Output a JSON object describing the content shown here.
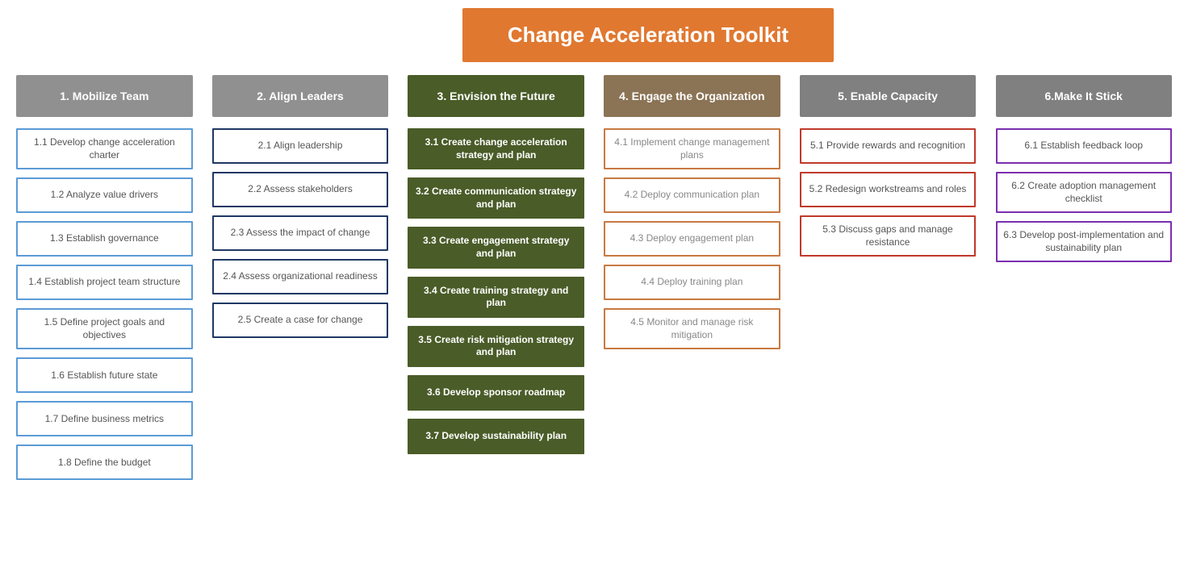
{
  "title": "Change Acceleration Toolkit",
  "cursor_visible": true,
  "columns": [
    {
      "id": "col1",
      "header": "1. Mobilize Team",
      "header_style": "gray",
      "cards": [
        {
          "label": "1.1 Develop change acceleration charter",
          "style": "border-blue"
        },
        {
          "label": "1.2 Analyze value drivers",
          "style": "border-blue"
        },
        {
          "label": "1.3 Establish governance",
          "style": "border-blue"
        },
        {
          "label": "1.4 Establish project team structure",
          "style": "border-blue"
        },
        {
          "label": "1.5 Define project goals and objectives",
          "style": "border-blue"
        },
        {
          "label": "1.6 Establish future state",
          "style": "border-blue"
        },
        {
          "label": "1.7 Define business metrics",
          "style": "border-blue"
        },
        {
          "label": "1.8 Define the budget",
          "style": "border-blue"
        }
      ]
    },
    {
      "id": "col2",
      "header": "2. Align Leaders",
      "header_style": "gray",
      "cards": [
        {
          "label": "2.1 Align leadership",
          "style": "border-dark-blue"
        },
        {
          "label": "2.2 Assess stakeholders",
          "style": "border-dark-blue"
        },
        {
          "label": "2.3 Assess the impact of change",
          "style": "border-dark-blue"
        },
        {
          "label": "2.4 Assess organizational readiness",
          "style": "border-dark-blue"
        },
        {
          "label": "2.5 Create a case for change",
          "style": "border-dark-blue"
        }
      ]
    },
    {
      "id": "col3",
      "header": "3. Envision the Future",
      "header_style": "dark-green",
      "cards": [
        {
          "label": "3.1 Create change acceleration strategy and plan",
          "style": "border-green-fill"
        },
        {
          "label": "3.2 Create communication strategy and plan",
          "style": "border-green-fill"
        },
        {
          "label": "3.3 Create engagement strategy and plan",
          "style": "border-green-fill"
        },
        {
          "label": "3.4 Create training strategy and plan",
          "style": "border-green-fill"
        },
        {
          "label": "3.5 Create risk mitigation strategy and plan",
          "style": "border-green-fill"
        },
        {
          "label": "3.6 Develop sponsor roadmap",
          "style": "border-green-fill"
        },
        {
          "label": "3.7 Develop sustainability plan",
          "style": "border-green-fill"
        }
      ]
    },
    {
      "id": "col4",
      "header": "4. Engage the Organization",
      "header_style": "tan",
      "cards": [
        {
          "label": "4.1 Implement change management plans",
          "style": "border-brown"
        },
        {
          "label": "4.2 Deploy communication plan",
          "style": "border-brown"
        },
        {
          "label": "4.3 Deploy engagement plan",
          "style": "border-brown"
        },
        {
          "label": "4.4 Deploy training plan",
          "style": "border-brown"
        },
        {
          "label": "4.5 Monitor and manage risk mitigation",
          "style": "border-brown"
        }
      ]
    },
    {
      "id": "col5",
      "header": "5. Enable Capacity",
      "header_style": "medium-gray",
      "cards": [
        {
          "label": "5.1 Provide rewards and recognition",
          "style": "border-red"
        },
        {
          "label": "5.2 Redesign workstreams and roles",
          "style": "border-red"
        },
        {
          "label": "5.3 Discuss gaps and manage resistance",
          "style": "border-red"
        }
      ]
    },
    {
      "id": "col6",
      "header": "6.Make It Stick",
      "header_style": "medium-gray",
      "cards": [
        {
          "label": "6.1 Establish feedback loop",
          "style": "border-purple"
        },
        {
          "label": "6.2 Create adoption management checklist",
          "style": "border-purple"
        },
        {
          "label": "6.3 Develop post-implementation and sustainability plan",
          "style": "border-purple"
        }
      ]
    }
  ]
}
